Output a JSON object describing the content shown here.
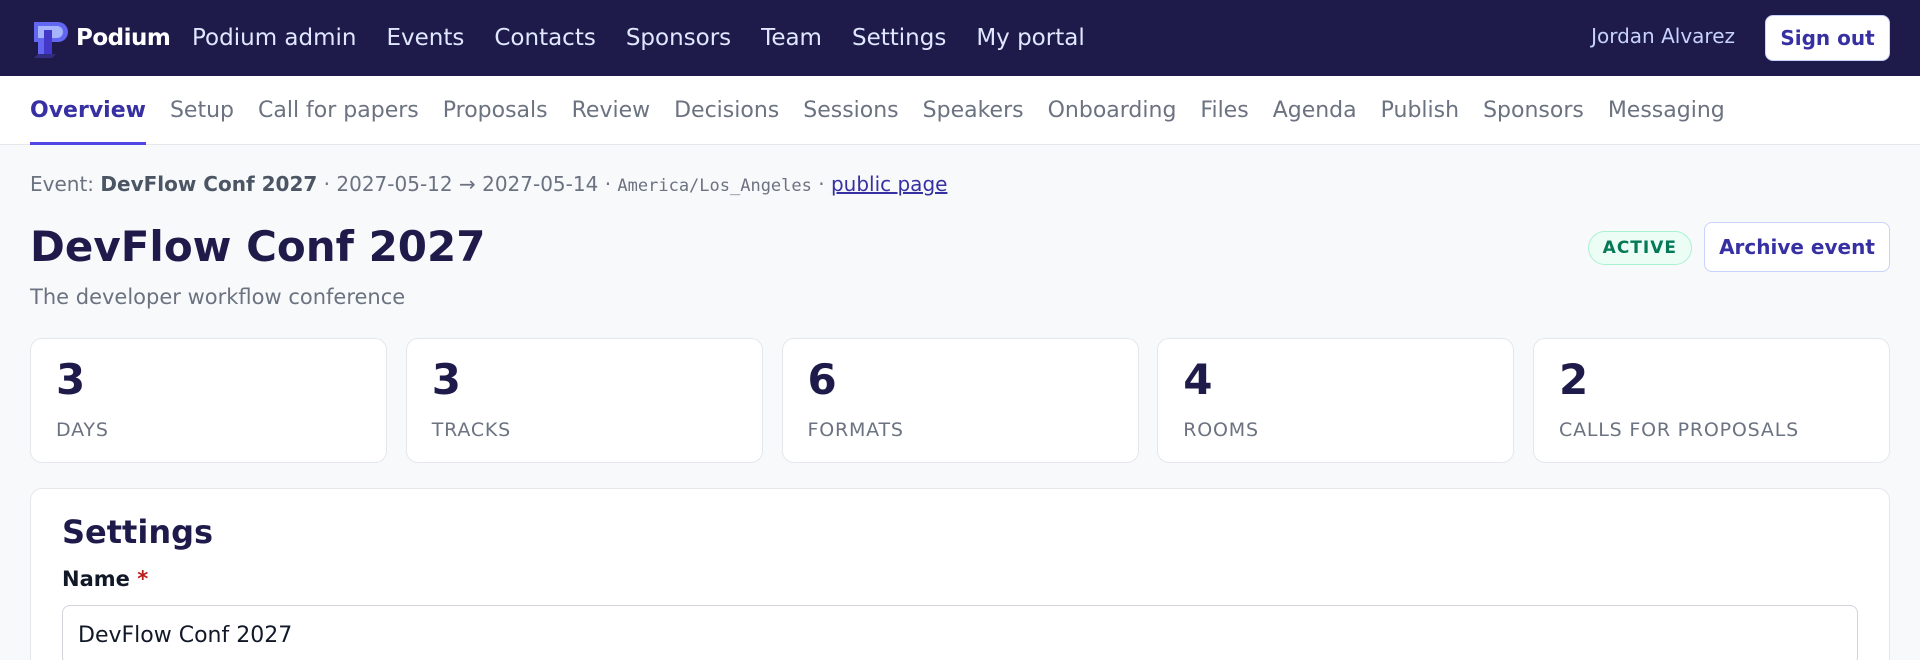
{
  "brand": {
    "name": "Podium",
    "accent": "#4f46e5",
    "dark": "#1e1b4b"
  },
  "topnav": {
    "items": [
      "Podium admin",
      "Events",
      "Contacts",
      "Sponsors",
      "Team",
      "Settings",
      "My portal"
    ],
    "user": "Jordan Alvarez",
    "sign_out": "Sign out"
  },
  "subnav": {
    "active": "Overview",
    "items": [
      "Overview",
      "Setup",
      "Call for papers",
      "Proposals",
      "Review",
      "Decisions",
      "Sessions",
      "Speakers",
      "Onboarding",
      "Files",
      "Agenda",
      "Publish",
      "Sponsors",
      "Messaging"
    ]
  },
  "event": {
    "prefix": "Event:",
    "name": "DevFlow Conf 2027",
    "start": "2027-05-12",
    "arrow": "→",
    "end": "2027-05-14",
    "timezone": "America/Los_Angeles",
    "public_link": "public page",
    "title": "DevFlow Conf 2027",
    "tagline": "The developer workflow conference",
    "status": "ACTIVE",
    "archive_label": "Archive event"
  },
  "stats": [
    {
      "value": "3",
      "label": "DAYS"
    },
    {
      "value": "3",
      "label": "TRACKS"
    },
    {
      "value": "6",
      "label": "FORMATS"
    },
    {
      "value": "4",
      "label": "ROOMS"
    },
    {
      "value": "2",
      "label": "CALLS FOR PROPOSALS"
    }
  ],
  "settings": {
    "title": "Settings",
    "name_label": "Name",
    "required_mark": "*",
    "name_value": "DevFlow Conf 2027"
  }
}
